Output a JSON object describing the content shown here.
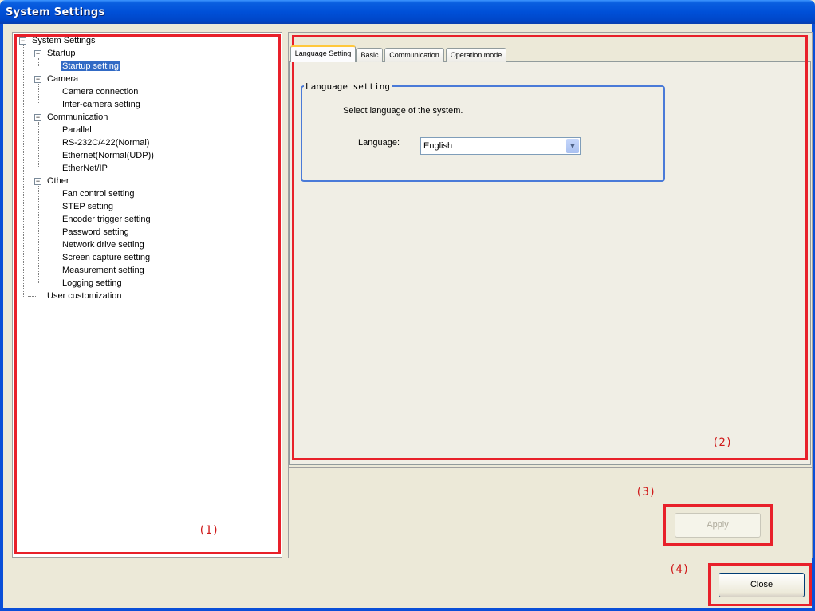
{
  "window": {
    "title": "System Settings"
  },
  "tree": {
    "nodes": [
      {
        "label": "System Settings",
        "depth": 0,
        "expander": "−"
      },
      {
        "label": "Startup",
        "depth": 1,
        "expander": "−"
      },
      {
        "label": "Startup setting",
        "depth": 2,
        "selected": true
      },
      {
        "label": "Camera",
        "depth": 1,
        "expander": "−"
      },
      {
        "label": "Camera connection",
        "depth": 2
      },
      {
        "label": "Inter-camera setting",
        "depth": 2
      },
      {
        "label": "Communication",
        "depth": 1,
        "expander": "−"
      },
      {
        "label": "Parallel",
        "depth": 2
      },
      {
        "label": "RS-232C/422(Normal)",
        "depth": 2
      },
      {
        "label": "Ethernet(Normal(UDP))",
        "depth": 2
      },
      {
        "label": "EtherNet/IP",
        "depth": 2
      },
      {
        "label": "Other",
        "depth": 1,
        "expander": "−"
      },
      {
        "label": "Fan control setting",
        "depth": 2
      },
      {
        "label": "STEP setting",
        "depth": 2
      },
      {
        "label": "Encoder trigger setting",
        "depth": 2
      },
      {
        "label": "Password setting",
        "depth": 2
      },
      {
        "label": "Network drive setting",
        "depth": 2
      },
      {
        "label": "Screen capture setting",
        "depth": 2
      },
      {
        "label": "Measurement setting",
        "depth": 2
      },
      {
        "label": "Logging setting",
        "depth": 2
      },
      {
        "label": "User customization",
        "depth": 1
      }
    ]
  },
  "tabs": [
    {
      "label": "Language Setting",
      "active": true
    },
    {
      "label": "Basic"
    },
    {
      "label": "Communication"
    },
    {
      "label": "Operation mode"
    }
  ],
  "language_group": {
    "title": "Language setting",
    "description": "Select language of the system.",
    "field_label": "Language:",
    "selected_value": "English"
  },
  "buttons": {
    "apply": "Apply",
    "close": "Close"
  },
  "callouts": {
    "c1": "(1)",
    "c2": "(2)",
    "c3": "(3)",
    "c4": "(4)"
  },
  "colors": {
    "titlebar": "#0050d8",
    "callout": "#e8202a",
    "selection": "#316ac5"
  }
}
